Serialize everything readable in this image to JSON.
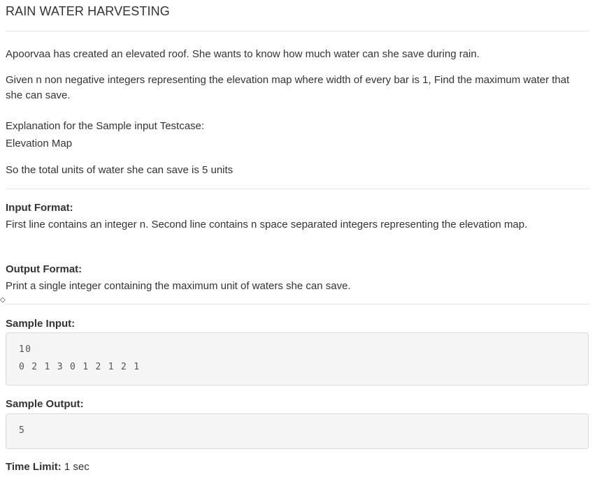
{
  "problem": {
    "title": "RAIN WATER HARVESTING",
    "intro": "Apoorvaa has created an elevated roof. She wants to know how much water can she save during rain.",
    "description": "Given n non negative integers representing the elevation map where width of every bar is 1, Find the maximum water that she can save.",
    "explanation_heading": "Explanation for the Sample input Testcase:",
    "elevation_map_label": "Elevation Map",
    "total_units": "So the total units of water she can save is 5 units"
  },
  "input_format": {
    "label": "Input Format:",
    "text": "First line contains an integer n. Second line contains n space separated integers representing the elevation map."
  },
  "output_format": {
    "label": "Output Format:",
    "text": "Print a single integer containing the maximum unit of waters she can save."
  },
  "sample_input": {
    "label": "Sample Input:",
    "line1": "10",
    "line2": "0 2 1 3 0 1 2 1 2 1"
  },
  "sample_output": {
    "label": "Sample Output:",
    "value": "5"
  },
  "time_limit": {
    "label": "Time Limit:",
    "value": "1 sec"
  },
  "icons": {
    "cursor": "diamond-cursor-icon"
  }
}
